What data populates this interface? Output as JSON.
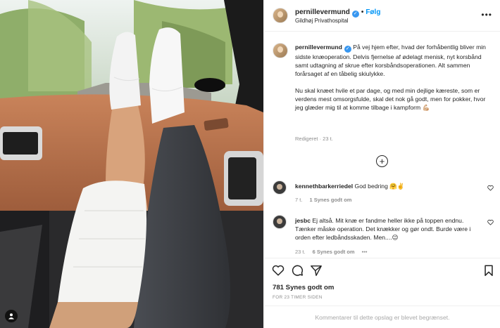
{
  "post": {
    "username": "pernillevermund",
    "verified_icon": "verified-check-icon",
    "dot": "•",
    "follow_label": "Følg",
    "location": "Gildhøj Privathospital",
    "more_icon": "more-options-icon"
  },
  "caption": {
    "username": "pernillevermund",
    "paragraph1": "På vej hjem efter, hvad der forhåbentlig bliver min sidste knæoperation. Delvis fjernelse af ødelagt menisk, nyt korsbånd samt udtagning af skrue efter korsbåndsoperationen. Alt sammen forårsaget af en tåbelig skiulykke.",
    "paragraph2": "Nu skal knæet hvile et par dage, og med min dejlige kæreste, som er verdens mest omsorgsfulde, skal det nok gå godt, men for pokker, hvor jeg glæder mig til at komme tilbage i kampform 💪🏼",
    "meta": "Redigeret · 23 t."
  },
  "load_more_icon": "plus-circle-icon",
  "comments": [
    {
      "username": "kennethbarkerriedel",
      "text": "God bedring 🤗✌️",
      "time": "7 t.",
      "likes": "1 Synes godt om"
    },
    {
      "username": "jesbc",
      "text": "Ej altså. Mit knæ er fandme heller ikke på toppen endnu. Tænker måske operation. Det knækker og gør ondt. Burde være i orden efter ledbåndsskaden. Men....😉",
      "time": "23 t.",
      "likes": "6 Synes godt om",
      "more": "•••"
    }
  ],
  "actions": {
    "likes_count": "781 Synes godt om",
    "timestamp": "FOR 23 TIMER SIDEN",
    "comments_limited": "Kommentarer til dette opslag er blevet begrænset."
  },
  "colors": {
    "accent": "#0095f6",
    "verified": "#3897f0",
    "muted": "#8e8e8e",
    "border": "#efefef"
  }
}
